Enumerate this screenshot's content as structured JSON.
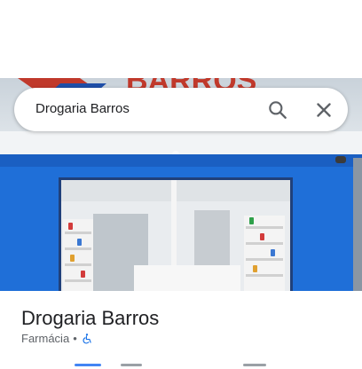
{
  "search": {
    "query": "Drogaria Barros"
  },
  "place": {
    "name": "Drogaria Barros",
    "category": "Farmácia",
    "separator": "•"
  },
  "photo": {
    "sign_text": "BARROS"
  },
  "icons": {
    "search": "search-icon",
    "close": "close-icon",
    "accessibility": "wheelchair-accessible-icon"
  },
  "colors": {
    "accent": "#1a73e8",
    "storefront": "#1f6fd8",
    "sign": "#c0392b"
  }
}
